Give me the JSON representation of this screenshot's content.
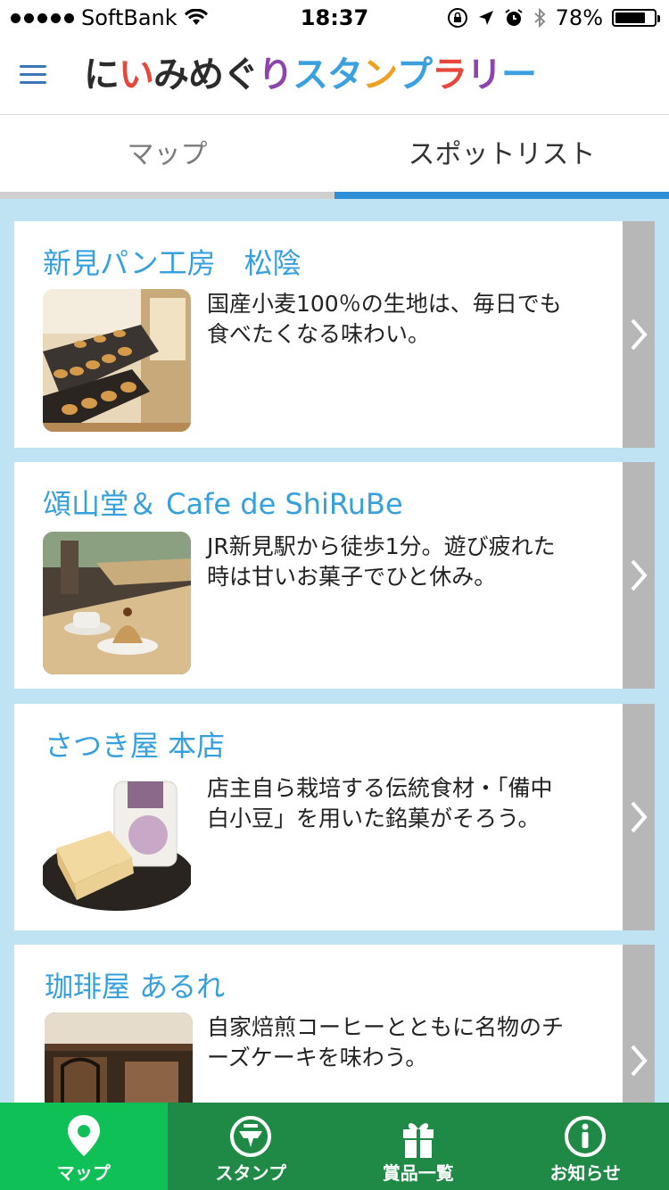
{
  "status": {
    "carrier": "SoftBank",
    "time": "18:37",
    "battery_pct": "78%",
    "battery_level": 0.78
  },
  "header": {
    "logo_chars": [
      {
        "char": "に",
        "color": "#2b2b2b"
      },
      {
        "char": "い",
        "color": "#e8463a"
      },
      {
        "char": "み",
        "color": "#2b2b2b"
      },
      {
        "char": "め",
        "color": "#2b2b2b"
      },
      {
        "char": "ぐ",
        "color": "#2b2b2b"
      },
      {
        "char": "り",
        "color": "#8e44ad"
      },
      {
        "char": "ス",
        "color": "#3aa0e0"
      },
      {
        "char": "タ",
        "color": "#3aa0e0"
      },
      {
        "char": "ン",
        "color": "#f0a020"
      },
      {
        "char": "プ",
        "color": "#3aa0e0"
      },
      {
        "char": "ラ",
        "color": "#e8463a"
      },
      {
        "char": "リ",
        "color": "#8e44ad"
      },
      {
        "char": "ー",
        "color": "#3aa0e0"
      }
    ]
  },
  "tabs": {
    "map": "マップ",
    "spot_list": "スポットリスト"
  },
  "spots": [
    {
      "title": "新見パン工房　松陰",
      "desc": "国産小麦100％の生地は、毎日でも食べたくなる味わい。",
      "image": "bakery-photo"
    },
    {
      "title": "頌山堂＆ Cafe de ShiRuBe",
      "desc": "JR新見駅から徒歩1分。遊び疲れた時は甘いお菓子でひと休み。",
      "image": "cafe-photo"
    },
    {
      "title": "さつき屋 本店",
      "desc": "店主自ら栽培する伝統食材・「備中白小豆」を用いた銘菓がそろう。",
      "image": "sweets-photo"
    },
    {
      "title": "珈琲屋 あるれ",
      "desc": "自家焙煎コーヒーとともに名物のチーズケーキを味わう。",
      "image": "coffee-shop-photo"
    }
  ],
  "bottom_nav": [
    {
      "label": "マップ",
      "icon": "map-pin-icon",
      "active": true
    },
    {
      "label": "スタンプ",
      "icon": "stamp-icon",
      "active": false
    },
    {
      "label": "賞品一覧",
      "icon": "gift-icon",
      "active": false
    },
    {
      "label": "お知らせ",
      "icon": "info-icon",
      "active": false
    }
  ],
  "colors": {
    "accent_blue": "#2e8fd8",
    "title_blue": "#36a0dc",
    "nav_green": "#1f8a46",
    "nav_active_green": "#0ec056",
    "list_bg": "#bfe3f2"
  }
}
